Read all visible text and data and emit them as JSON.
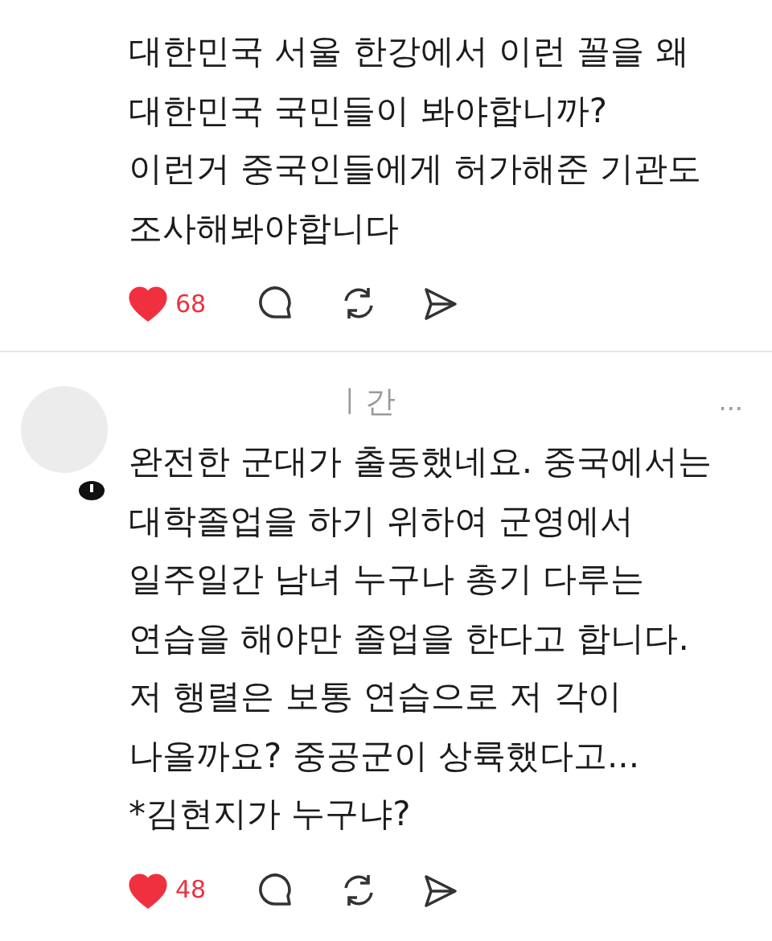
{
  "posts": [
    {
      "body": [
        "대한민국 서울 한강에서 이런 꼴을 왜",
        "대한민국 국민들이 봐야합니까?",
        "이런거 중국인들에게 허가해준 기관도",
        "조사해봐야합니다"
      ],
      "likes": "68",
      "liked": true
    },
    {
      "time": "ㅣ간",
      "more": "...",
      "body": [
        "완전한 군대가 출동했네요. 중국에서는",
        "대학졸업을 하기 위하여 군영에서",
        "일주일간 남녀 누구나 총기 다루는",
        "연습을 해야만 졸업을 한다고 합니다.",
        "저 행렬은 보통 연습으로 저 각이",
        "나올까요? 중공군이 상륙했다고...",
        "*김현지가 누구냐?"
      ],
      "likes": "48",
      "liked": true
    }
  ]
}
